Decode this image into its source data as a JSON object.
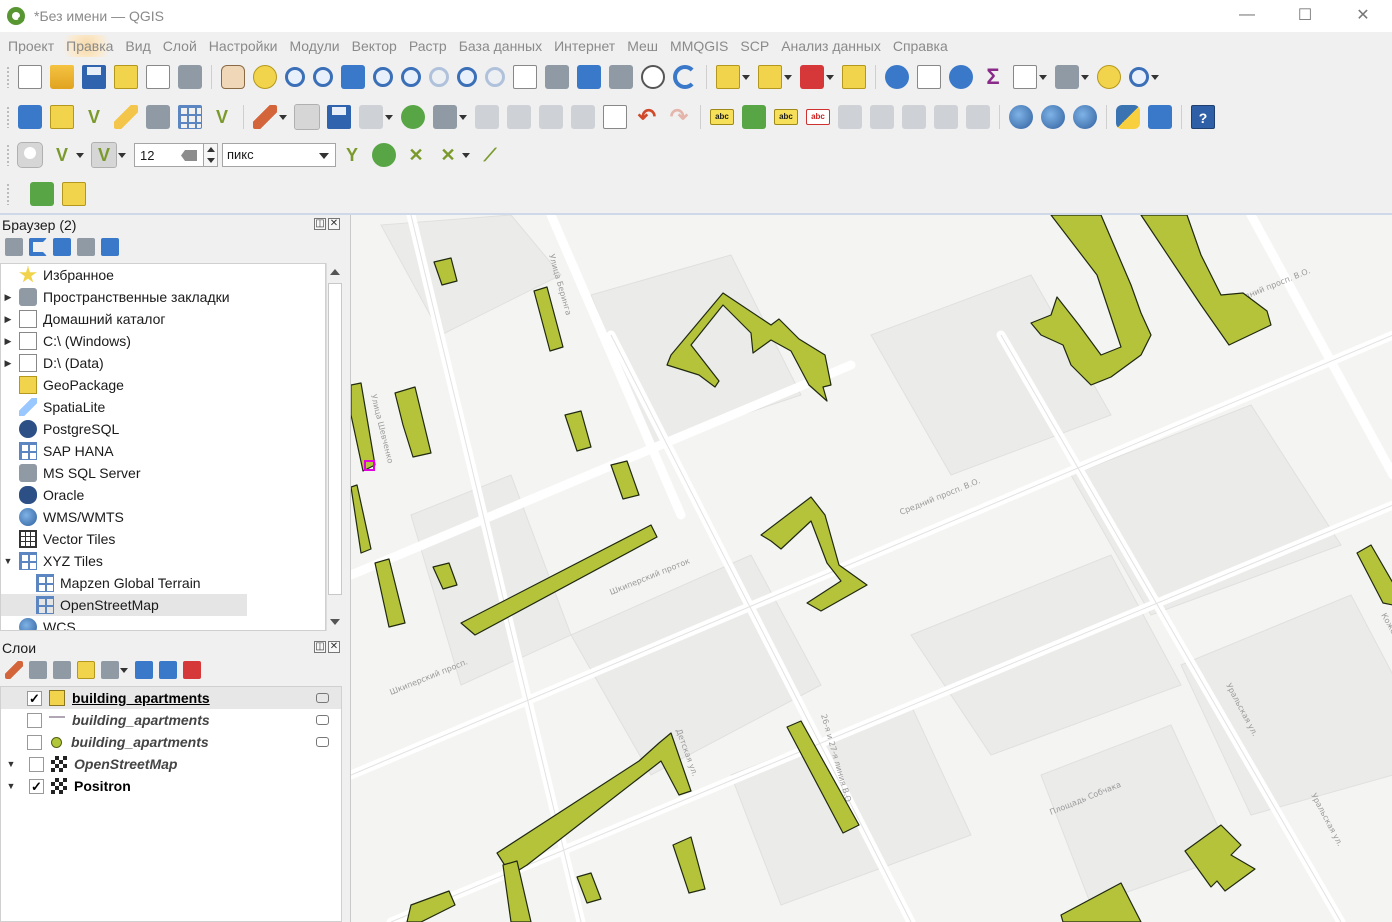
{
  "window": {
    "title": "*Без имени — QGIS",
    "controls": [
      "—",
      "☐",
      "✕"
    ]
  },
  "menu": [
    "Проект",
    "Правка",
    "Вид",
    "Слой",
    "Настройки",
    "Модули",
    "Вектор",
    "Растр",
    "База данных",
    "Интернет",
    "Меш",
    "MMQGIS",
    "SCP",
    "Анализ данных",
    "Справка"
  ],
  "snapping": {
    "tolerance_value": "12",
    "units": "пикс"
  },
  "browser": {
    "title": "Браузер (2)",
    "items": [
      {
        "label": "Избранное",
        "icon": "star-icon",
        "arrow": ""
      },
      {
        "label": "Пространственные закладки",
        "icon": "bookmarks-icon",
        "arrow": "▶"
      },
      {
        "label": "Домашний каталог",
        "icon": "home-folder-icon",
        "arrow": "▶"
      },
      {
        "label": "C:\\ (Windows)",
        "icon": "drive-icon",
        "arrow": "▶"
      },
      {
        "label": "D:\\ (Data)",
        "icon": "drive-icon",
        "arrow": "▶"
      },
      {
        "label": "GeoPackage",
        "icon": "geopackage-icon",
        "arrow": ""
      },
      {
        "label": "SpatiaLite",
        "icon": "spatialite-icon",
        "arrow": ""
      },
      {
        "label": "PostgreSQL",
        "icon": "postgresql-icon",
        "arrow": ""
      },
      {
        "label": "SAP HANA",
        "icon": "sap-hana-icon",
        "arrow": ""
      },
      {
        "label": "MS SQL Server",
        "icon": "mssql-icon",
        "arrow": ""
      },
      {
        "label": "Oracle",
        "icon": "oracle-icon",
        "arrow": ""
      },
      {
        "label": "WMS/WMTS",
        "icon": "wms-icon",
        "arrow": ""
      },
      {
        "label": "Vector Tiles",
        "icon": "vector-tiles-icon",
        "arrow": ""
      },
      {
        "label": "XYZ Tiles",
        "icon": "xyz-tiles-icon",
        "arrow": "▼"
      },
      {
        "label": "Mapzen Global Terrain",
        "icon": "xyz-layer-icon",
        "arrow": "",
        "child": true
      },
      {
        "label": "OpenStreetMap",
        "icon": "xyz-layer-icon",
        "arrow": "",
        "child": true,
        "selected": true
      },
      {
        "label": "WCS",
        "icon": "wcs-icon",
        "arrow": ""
      }
    ]
  },
  "layers": {
    "title": "Слои",
    "items": [
      {
        "label": "building_apartments",
        "checked": true,
        "symbol": "polygon-edit",
        "style": "current",
        "filter": true
      },
      {
        "label": "building_apartments",
        "checked": false,
        "symbol": "line",
        "style": "italic",
        "filter": true
      },
      {
        "label": "building_apartments",
        "checked": false,
        "symbol": "point",
        "style": "italic",
        "filter": true
      },
      {
        "label": "OpenStreetMap",
        "checked": false,
        "symbol": "tile",
        "style": "italic",
        "group_arrow": "▼"
      },
      {
        "label": "Positron",
        "checked": true,
        "symbol": "tile",
        "style": "bold",
        "group_arrow": "▼"
      }
    ]
  },
  "map": {
    "building_fill": "#b5c33a",
    "building_stroke": "#1f2a10",
    "background": "#f4f4f2",
    "street_labels": [
      "Улица Шевченко",
      "Улица Беринга",
      "Шкиперский проток",
      "Средний просп. В.О.",
      "26-я и 27-я линия В.О.",
      "Кожевенная линия",
      "Уральская ул.",
      "Детская ул.",
      "Площадь Собчака",
      "Средний просп. В.О.",
      "Шкиперский просп.",
      "Уральская ул."
    ]
  },
  "colors": {
    "accent_selection": "#d6d6d6",
    "highlight_menu": "#f6d9a8"
  }
}
